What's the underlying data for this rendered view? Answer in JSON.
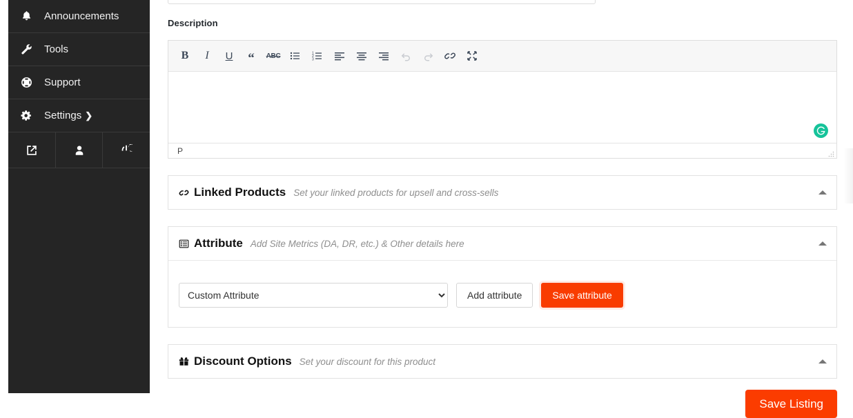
{
  "sidebar": {
    "items": [
      {
        "label": "Announcements",
        "icon": "bell-icon"
      },
      {
        "label": "Tools",
        "icon": "wrench-icon"
      },
      {
        "label": "Support",
        "icon": "life-ring-icon"
      },
      {
        "label": "Settings",
        "icon": "gear-icon",
        "chevron": "❯"
      }
    ],
    "bottom_icons": [
      {
        "name": "external-link-icon"
      },
      {
        "name": "user-icon"
      },
      {
        "name": "power-icon"
      }
    ]
  },
  "description": {
    "label": "Description",
    "toolbar": [
      {
        "name": "bold-button",
        "glyph": "B"
      },
      {
        "name": "italic-button",
        "glyph": "I"
      },
      {
        "name": "underline-button",
        "glyph": "U"
      },
      {
        "name": "blockquote-button",
        "glyph": "“"
      },
      {
        "name": "strikethrough-button",
        "glyph": "ABC"
      },
      {
        "name": "bullet-list-button",
        "glyph": ""
      },
      {
        "name": "numbered-list-button",
        "glyph": ""
      },
      {
        "name": "align-left-button",
        "glyph": ""
      },
      {
        "name": "align-center-button",
        "glyph": ""
      },
      {
        "name": "align-right-button",
        "glyph": ""
      },
      {
        "name": "undo-button",
        "glyph": ""
      },
      {
        "name": "redo-button",
        "glyph": ""
      },
      {
        "name": "link-button",
        "glyph": ""
      },
      {
        "name": "fullscreen-button",
        "glyph": ""
      }
    ],
    "content": "",
    "status_path": "P",
    "grammarly_badge": "G"
  },
  "panels": {
    "linked_products": {
      "title": "Linked Products",
      "subtitle": "Set your linked products for upsell and cross-sells",
      "icon": "link-icon"
    },
    "attribute": {
      "title": "Attribute",
      "subtitle": "Add Site Metrics (DA, DR, etc.) & Other details here",
      "icon": "list-table-icon",
      "select": {
        "selected": "Custom Attribute",
        "options": [
          "Custom Attribute"
        ]
      },
      "add_button": "Add attribute",
      "save_button": "Save attribute"
    },
    "discount_options": {
      "title": "Discount Options",
      "subtitle": "Set your discount for this product",
      "icon": "gift-icon"
    }
  },
  "footer": {
    "save_listing": "Save Listing"
  },
  "colors": {
    "accent_orange": "#fb3c00",
    "sidebar_dark": "#252525",
    "grammarly_green": "#15c39a"
  }
}
